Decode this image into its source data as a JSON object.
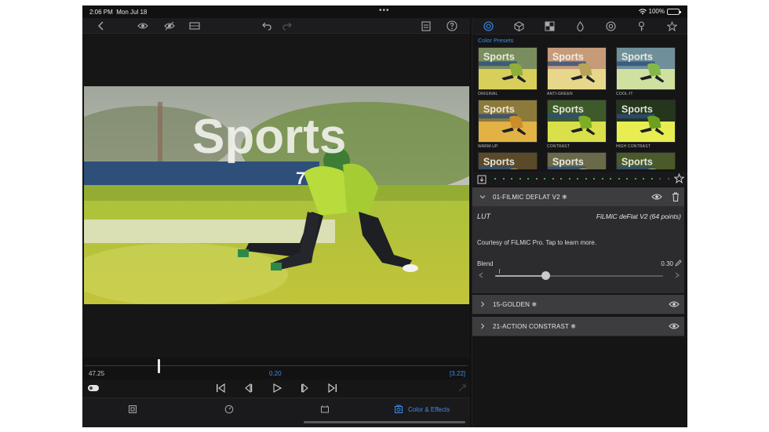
{
  "status": {
    "time": "2:06 PM",
    "date": "Mon Jul 18",
    "battery": "100%",
    "battery_level": 1.0
  },
  "viewer": {
    "title_overlay": "Sports",
    "jersey_number": "7"
  },
  "timeline": {
    "start": "47.25",
    "current": "0.20",
    "end": "[3.22]",
    "playhead_fraction": 0.19
  },
  "tabs": {
    "color_effects_label": "Color & Effects"
  },
  "panel": {
    "presets_title": "Color Presets",
    "thumb_text": "Sports",
    "presets": [
      {
        "label": "ORIGINAL"
      },
      {
        "label": "ANTI-GREEN"
      },
      {
        "label": "COOL-IT"
      },
      {
        "label": "WARM-UP"
      },
      {
        "label": "CONTRAST"
      },
      {
        "label": "HIGH CONTRAST"
      },
      {
        "label": ""
      },
      {
        "label": ""
      },
      {
        "label": ""
      }
    ],
    "layers": [
      {
        "name": "01-FILMIC DEFLAT V2 ❄"
      },
      {
        "name": "15-GOLDEN ❄"
      },
      {
        "name": "21-ACTION CONSTRAST ❄"
      }
    ],
    "expanded": {
      "lut_label": "LUT",
      "lut_value": "FiLMiC deFlat V2 (64 points)",
      "description": "Courtesy of FiLMiC Pro. Tap to learn more.",
      "blend_label": "Blend",
      "blend_value": "0.30",
      "blend_fraction": 0.3
    }
  },
  "icons": {
    "toolbar": [
      "back-chevron-icon",
      "eye-icon",
      "eye-slash-icon",
      "clip-settings-icon",
      "undo-icon",
      "redo-icon",
      "clipboard-icon",
      "help-icon"
    ],
    "panel_tabs": [
      "color-wheel-icon",
      "cube-icon",
      "grid-icon",
      "drop-icon",
      "target-icon",
      "key-icon",
      "star-icon"
    ],
    "transport": [
      "skip-start-icon",
      "step-back-icon",
      "play-icon",
      "step-forward-icon",
      "skip-end-icon"
    ]
  },
  "colors": {
    "accent": "#3a8ff0",
    "active_dot": "#4cd964",
    "battery": "#4cd964"
  }
}
